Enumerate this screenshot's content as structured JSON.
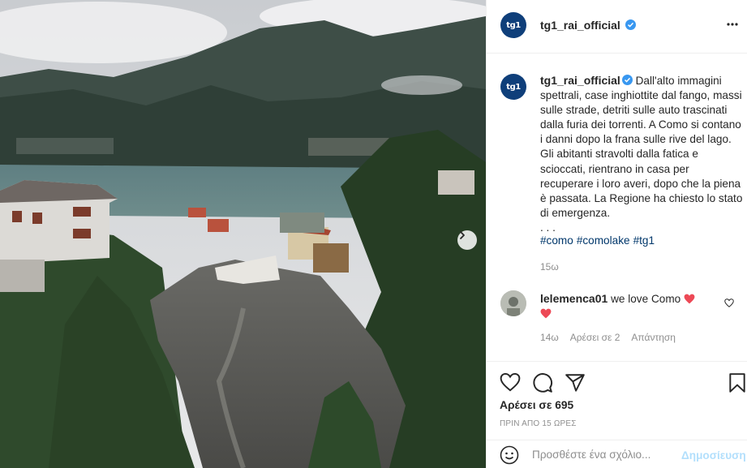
{
  "post": {
    "account": "tg1_rai_official",
    "avatar_text": "tg1",
    "caption": "Dall'alto immagini spettrali, case inghiottite dal fango, massi sulle strade, detriti sulle auto trascinati dalla furia dei torrenti. A Como si contano i danni dopo la frana sulle rive del lago. Gli abitanti stravolti dalla fatica e scioccati, rientrano in casa per recuperare i loro averi, dopo che la piena è passata. La Regione ha chiesto lo stato di emergenza.",
    "ellipsis": ". . .",
    "hashtags": [
      "#como",
      "#comolake",
      "#tg1"
    ],
    "caption_time": "15ω",
    "likes": "Αρέσει σε 695",
    "posted": "ΠΡΙΝ ΑΠΟ 15 ΩΡΕΣ"
  },
  "comment": {
    "user": "lelemenca01",
    "text": "we love Como",
    "time": "14ω",
    "likes": "Αρέσει σε 2",
    "reply": "Απάντηση"
  },
  "add_comment": {
    "placeholder": "Προσθέστε ένα σχόλιο...",
    "post_label": "Δημοσίευση"
  },
  "icons": {
    "more": "more-options-icon",
    "next": "chevron-right-icon",
    "like": "heart-icon",
    "comment": "comment-icon",
    "share": "share-icon",
    "save": "bookmark-icon",
    "emoji": "emoji-icon"
  },
  "colors": {
    "brand": "#0f3f7a",
    "verified": "#3897f0",
    "hashtag": "#00376b",
    "heart": "#ed4956",
    "muted": "#8e8e8e",
    "post_disabled": "#b2dffc"
  }
}
